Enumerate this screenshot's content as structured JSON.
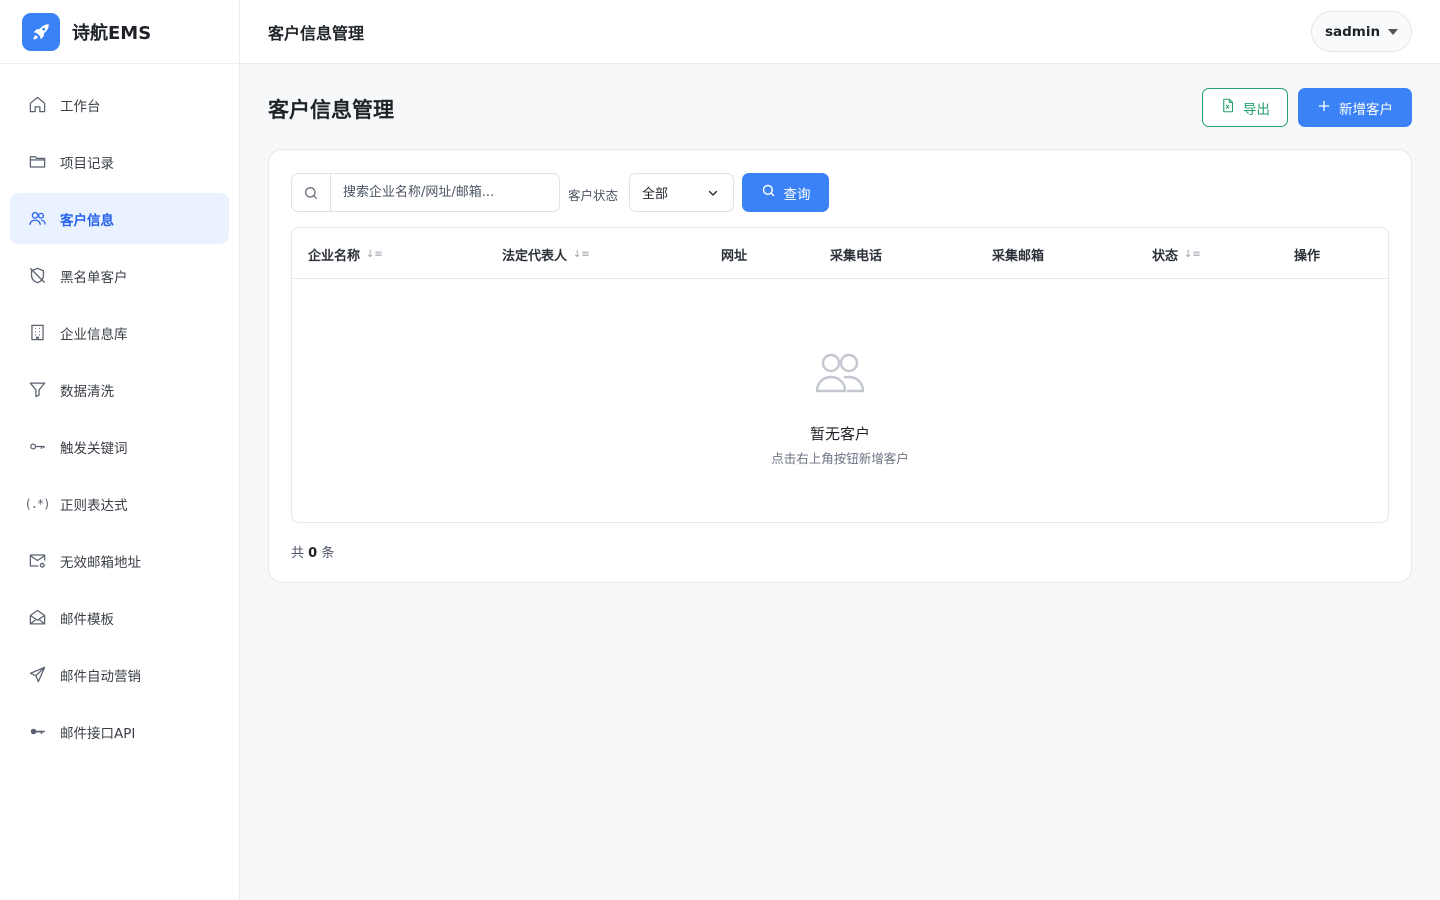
{
  "brand": {
    "name": "诗航EMS",
    "accent": "#3b82f6"
  },
  "sidebar": {
    "items": [
      {
        "label": "工作台",
        "icon": "home-icon"
      },
      {
        "label": "项目记录",
        "icon": "folder-icon"
      },
      {
        "label": "客户信息",
        "icon": "users-icon",
        "active": true
      },
      {
        "label": "黑名单客户",
        "icon": "shield-off-icon"
      },
      {
        "label": "企业信息库",
        "icon": "building-icon"
      },
      {
        "label": "数据清洗",
        "icon": "filter-icon"
      },
      {
        "label": "触发关键词",
        "icon": "key-icon"
      },
      {
        "label": "正则表达式",
        "icon": "regex-icon"
      },
      {
        "label": "无效邮箱地址",
        "icon": "mail-x-icon"
      },
      {
        "label": "邮件模板",
        "icon": "mail-open-icon"
      },
      {
        "label": "邮件自动营销",
        "icon": "send-icon"
      },
      {
        "label": "邮件接口API",
        "icon": "api-key-icon"
      }
    ],
    "regex_glyph": "(.*)"
  },
  "header": {
    "title": "客户信息管理",
    "user": "sadmin"
  },
  "main": {
    "title": "客户信息管理",
    "export_label": "导出",
    "add_label": "新增客户",
    "search": {
      "placeholder": "搜索企业名称/网址/邮箱..."
    },
    "filter": {
      "label": "客户状态",
      "selected": "全部"
    },
    "query_label": "查询",
    "table": {
      "columns": [
        "企业名称",
        "法定代表人",
        "网址",
        "采集电话",
        "采集邮箱",
        "状态",
        "操作"
      ],
      "sortable": [
        true,
        true,
        false,
        false,
        false,
        true,
        false
      ],
      "rows": []
    },
    "empty": {
      "title": "暂无客户",
      "subtitle": "点击右上角按钮新增客户"
    },
    "total": {
      "prefix": "共",
      "count": "0",
      "suffix": "条"
    }
  }
}
